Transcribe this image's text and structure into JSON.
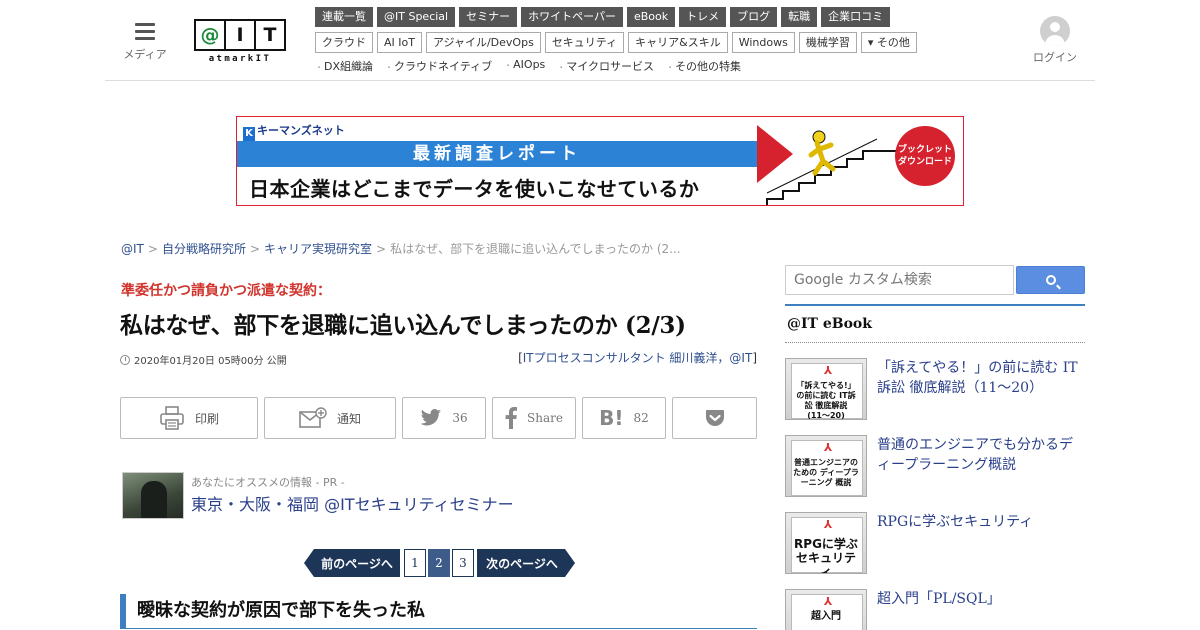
{
  "header": {
    "menu_label": "メディア",
    "logo_letters": [
      "@",
      "I",
      "T"
    ],
    "logo_sub": "atmarkIT",
    "login_label": "ログイン",
    "nav_primary": [
      "連載一覧",
      "@IT Special",
      "セミナー",
      "ホワイトペーパー",
      "eBook",
      "トレメ",
      "ブログ",
      "転職",
      "企業口コミ"
    ],
    "nav_secondary": [
      "クラウド",
      "AI IoT",
      "アジャイル/DevOps",
      "セキュリティ",
      "キャリア&スキル",
      "Windows",
      "機械学習",
      "▾ その他"
    ],
    "nav_features": [
      "DX組織論",
      "クラウドネイティブ",
      "AIOps",
      "マイクロサービス",
      "その他の特集"
    ]
  },
  "banner": {
    "brand": "キーマンズネット",
    "headline": "最新調査レポート",
    "subline": "日本企業はどこまでデータを使いこなせているか",
    "badge": "ブックレット\nダウンロード"
  },
  "breadcrumb": {
    "items": [
      "@IT",
      "自分戦略研究所",
      "キャリア実現研究室"
    ],
    "separator": ">",
    "current": "私はなぜ、部下を退職に追い込んでしまったのか (2..."
  },
  "article": {
    "kicker": "準委任かつ請負かつ派遣な契約：",
    "title": "私はなぜ、部下を退職に追い込んでしまったのか (2/3)",
    "date": "2020年01月20日 05時00分 公開",
    "byline_open": "[",
    "author": "ITプロセスコンサルタント 細川義洋，@IT",
    "byline_close": "]"
  },
  "share": {
    "print": "印刷",
    "notify": "通知",
    "twitter_count": "36",
    "facebook": "Share",
    "hatena_count": "82"
  },
  "pr": {
    "label": "あなたにオススメの情報 - PR -",
    "link": "東京・大阪・福岡 @ITセキュリティセミナー"
  },
  "pagination": {
    "prev": "前のページへ",
    "pages": [
      "1",
      "2",
      "3"
    ],
    "current": "2",
    "next": "次のページへ"
  },
  "section_heading": "曖昧な契約が原因で部下を失った私",
  "sidebar": {
    "search_placeholder": "Google カスタム検索",
    "ebook_heading": "@IT eBook",
    "ebooks": [
      {
        "cover": "「訴えてやる!」の前に読む IT訴訟 徹底解説 (11〜20)",
        "title": "「訴えてやる！」の前に読む IT訴訟 徹底解説（11～20）"
      },
      {
        "cover": "普通エンジニアのための ディープラーニング 概説",
        "title": "普通のエンジニアでも分かるディープラーニング概説"
      },
      {
        "cover": "RPGに学ぶ セキュリティ",
        "title": "RPGに学ぶセキュリティ"
      },
      {
        "cover": "超入門",
        "title": "超入門「PL/SQL」"
      }
    ]
  },
  "colors": {
    "kicker": "#d0342c",
    "link": "#2a3f8a",
    "nav_primary_bg": "#555555",
    "pagination": "#1d3556",
    "section_accent": "#3d7fbf",
    "search_button": "#5b8ee0",
    "banner_red": "#d6222e",
    "banner_blue": "#2c83d6"
  }
}
